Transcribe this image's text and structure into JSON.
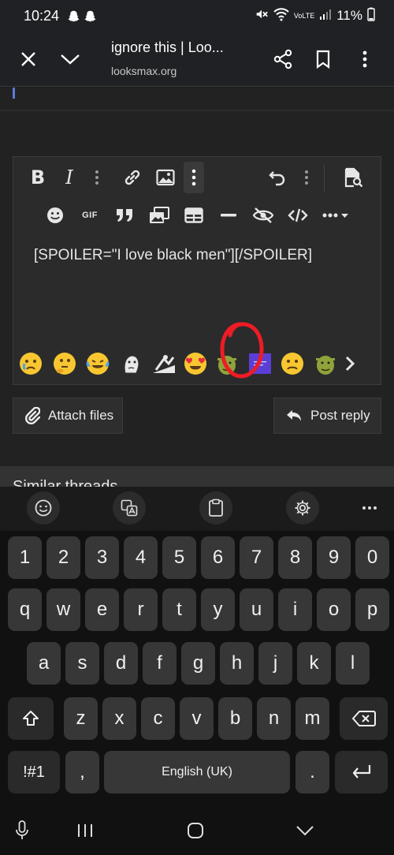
{
  "status_bar": {
    "time": "10:24",
    "battery": "11%",
    "network_label": "VoLTE"
  },
  "browser": {
    "page_title": "ignore this | Loo...",
    "domain": "looksmax.org"
  },
  "editor": {
    "text": "[SPOILER=\"I love black men\"][/SPOILER]",
    "toolbar_row1": [
      "bold-icon",
      "italic-icon",
      "more-vert-icon",
      "link-icon",
      "image-icon",
      "more-vert-icon",
      "undo-icon",
      "more-vert-icon",
      "preview-icon"
    ],
    "toolbar_row2_gif": "GIF",
    "toolbar_row2": [
      "smiley-icon",
      "gif-icon",
      "quote-icon",
      "media-icon",
      "table-icon",
      "hr-icon",
      "spoiler-icon",
      "code-icon",
      "more-icon"
    ],
    "bold_glyph": "B",
    "italic_glyph": "I",
    "emoji_row": [
      "😢",
      "🤔",
      "😂",
      "🗿",
      "🏂",
      "😍",
      "👾",
      "🟪",
      "🙁",
      "👾"
    ]
  },
  "buttons": {
    "attach": "Attach files",
    "post": "Post reply"
  },
  "section": {
    "title": "Similar threads"
  },
  "keyboard": {
    "row_numbers": [
      "1",
      "2",
      "3",
      "4",
      "5",
      "6",
      "7",
      "8",
      "9",
      "0"
    ],
    "row_q": [
      "q",
      "w",
      "e",
      "r",
      "t",
      "y",
      "u",
      "i",
      "o",
      "p"
    ],
    "row_a": [
      "a",
      "s",
      "d",
      "f",
      "g",
      "h",
      "j",
      "k",
      "l"
    ],
    "row_z": [
      "z",
      "x",
      "c",
      "v",
      "b",
      "n",
      "m"
    ],
    "symbols_key": "!#1",
    "comma_key": ",",
    "space_label": "English (UK)",
    "period_key": "."
  },
  "colors": {
    "accent_blue": "#5b7bd5",
    "annotation_red": "#ee1c24"
  }
}
